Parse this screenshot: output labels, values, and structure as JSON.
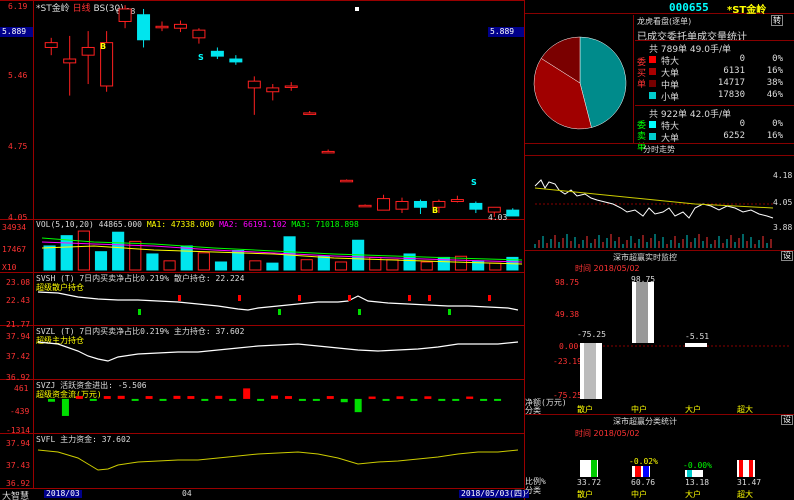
{
  "main": {
    "title": "*ST金岭",
    "period": "日线",
    "bs_label": "BS(30)",
    "peak_label": "6.18",
    "low_label": "4.03",
    "price_axis": [
      "6.19",
      "5.46",
      "4.75",
      "4.05"
    ],
    "current_price_left": "5.889",
    "current_price_right": "5.889",
    "markers": {
      "b": "B",
      "s": "S"
    }
  },
  "volume": {
    "header_label": "VOL(5,10,20)",
    "header_value": "44865.000",
    "ma1": "MA1: 47338.000",
    "ma2": "MA2: 66191.102",
    "ma3": "MA3: 71018.898",
    "axis": [
      "34934",
      "17467",
      "X10"
    ]
  },
  "svsh": {
    "header": "SVSH (T) 7日内买卖净占比0.219% 散户持仓: 22.224",
    "sub": "超级散户持仓",
    "axis": [
      "23.08",
      "22.43",
      "21.77"
    ]
  },
  "svzl": {
    "header": "SVZL (T) 7日内买卖净占比0.219% 主力持仓: 37.602",
    "sub": "超级主力持仓",
    "axis": [
      "37.94",
      "37.42",
      "36.92"
    ]
  },
  "svzj": {
    "header": "SVZJ 活跃资金进出: -5.506",
    "sub": "超级资金流(万元)",
    "axis": [
      "461",
      "-439",
      "-1314"
    ]
  },
  "svfl": {
    "header": "SVFL 主力资金: 37.602",
    "axis": [
      "37.94",
      "37.43",
      "36.92"
    ]
  },
  "bottom": {
    "brand": "大智慧",
    "date1": "2018/03",
    "date2": "04",
    "date3": "2018/05/03(四)"
  },
  "right": {
    "code": "000655",
    "name": "*ST金岭",
    "tab_label": "转",
    "panel_title": "龙虎看盘(逐单)",
    "order_title": "已成交委托单成交量统计",
    "buy": {
      "side_label": "委买单",
      "total": "共 789单 49.0手/单",
      "rows": [
        {
          "label": "特大",
          "vol": "0",
          "pct": "0%"
        },
        {
          "label": "大单",
          "vol": "6131",
          "pct": "16%"
        },
        {
          "label": "中单",
          "vol": "14717",
          "pct": "38%"
        },
        {
          "label": "小单",
          "vol": "17830",
          "pct": "46%"
        }
      ]
    },
    "sell": {
      "side_label": "委卖单",
      "total": "共 922单 42.0手/单",
      "rows": [
        {
          "label": "特大",
          "vol": "0",
          "pct": "0%"
        },
        {
          "label": "大单",
          "vol": "6252",
          "pct": "16%"
        }
      ]
    },
    "intraday_title": "分时走势",
    "intraday_prices": [
      "4.18",
      "4.05",
      "3.88"
    ],
    "realtime_title": "深市超赢实时监控",
    "realtime_tab": "设",
    "realtime_time": "时间  2018/05/02",
    "realtime_axis": [
      "98.75",
      "49.38",
      "0.00",
      "-23.19",
      "-75.25"
    ],
    "realtime_vals": {
      "a": "-75.25",
      "b": "98.75",
      "c": "-5.51"
    },
    "net_label": "净额(万元)",
    "cat_label": "分类",
    "categories": [
      "散户",
      "中户",
      "大户",
      "超大"
    ],
    "class_title": "深市超赢分类统计",
    "class_tab": "设",
    "class_time": "时间  2018/05/02",
    "class_axis_label": "比例%",
    "class_vals": {
      "a": "33.72",
      "b": "-0.02%",
      "b2": "60.76",
      "c": "-0.00%",
      "c2": "13.18",
      "d": "31.47"
    }
  },
  "chart_data": [
    {
      "type": "candlestick",
      "title": "*ST金岭",
      "ylim": [
        4.05,
        6.19
      ],
      "candles": [
        {
          "o": 5.78,
          "c": 5.83,
          "h": 5.88,
          "l": 5.7
        },
        {
          "o": 5.62,
          "c": 5.66,
          "h": 5.9,
          "l": 5.28
        },
        {
          "o": 5.7,
          "c": 5.78,
          "h": 5.95,
          "l": 5.4
        },
        {
          "o": 5.38,
          "c": 5.83,
          "h": 5.95,
          "l": 5.32
        },
        {
          "o": 6.05,
          "c": 6.18,
          "h": 6.22,
          "l": 5.98
        },
        {
          "o": 6.12,
          "c": 5.86,
          "h": 6.18,
          "l": 5.78
        },
        {
          "o": 6.0,
          "c": 6.0,
          "h": 6.05,
          "l": 5.95
        },
        {
          "o": 5.98,
          "c": 6.02,
          "h": 6.06,
          "l": 5.94
        },
        {
          "o": 5.88,
          "c": 5.96,
          "h": 5.98,
          "l": 5.82
        },
        {
          "o": 5.74,
          "c": 5.69,
          "h": 5.78,
          "l": 5.66
        },
        {
          "o": 5.66,
          "c": 5.63,
          "h": 5.7,
          "l": 5.6
        },
        {
          "o": 5.36,
          "c": 5.43,
          "h": 5.48,
          "l": 5.08
        },
        {
          "o": 5.32,
          "c": 5.36,
          "h": 5.4,
          "l": 5.23
        },
        {
          "o": 5.38,
          "c": 5.38,
          "h": 5.42,
          "l": 5.33
        },
        {
          "o": 5.1,
          "c": 5.1,
          "h": 5.12,
          "l": 5.08
        },
        {
          "o": 4.7,
          "c": 4.7,
          "h": 4.72,
          "l": 4.68
        },
        {
          "o": 4.4,
          "c": 4.4,
          "h": 4.41,
          "l": 4.39
        },
        {
          "o": 4.14,
          "c": 4.14,
          "h": 4.15,
          "l": 4.13
        },
        {
          "o": 4.09,
          "c": 4.21,
          "h": 4.25,
          "l": 4.09
        },
        {
          "o": 4.1,
          "c": 4.18,
          "h": 4.22,
          "l": 4.06
        },
        {
          "o": 4.18,
          "c": 4.12,
          "h": 4.2,
          "l": 4.05
        },
        {
          "o": 4.12,
          "c": 4.18,
          "h": 4.2,
          "l": 4.06
        },
        {
          "o": 4.18,
          "c": 4.2,
          "h": 4.24,
          "l": 4.17
        },
        {
          "o": 4.16,
          "c": 4.1,
          "h": 4.18,
          "l": 4.06
        },
        {
          "o": 4.07,
          "c": 4.12,
          "h": 4.12,
          "l": 4.02
        },
        {
          "o": 4.09,
          "c": 4.03,
          "h": 4.11,
          "l": 4.03
        }
      ],
      "bull_color": "#ff2020",
      "bear_color": "#00e5ee"
    },
    {
      "type": "bar",
      "title": "VOL(5,10,20)",
      "ylim": [
        0,
        34934
      ],
      "values": [
        21000,
        30000,
        34000,
        16000,
        33000,
        25000,
        14000,
        8000,
        21000,
        15000,
        7000,
        17000,
        8000,
        6000,
        29000,
        9000,
        12000,
        7000,
        26000,
        11000,
        9000,
        14000,
        7000,
        11000,
        12000,
        8000,
        6000,
        11000
      ],
      "bull_mask": [
        0,
        0,
        1,
        0,
        0,
        1,
        0,
        1,
        0,
        1,
        0,
        0,
        1,
        0,
        0,
        1,
        0,
        1,
        0,
        1,
        1,
        0,
        1,
        0,
        1,
        0,
        1,
        0
      ]
    },
    {
      "type": "bar",
      "title": "SVZJ",
      "ylim": [
        -1314,
        461
      ],
      "values": [
        -120,
        -720,
        120,
        -40,
        120,
        130,
        -30,
        120,
        -10,
        130,
        120,
        -30,
        130,
        -20,
        445,
        -30,
        140,
        120,
        -20,
        -40,
        120,
        -140,
        -560,
        100,
        -30,
        110,
        -40,
        110,
        -30,
        -40,
        100,
        -30,
        -40
      ]
    }
  ]
}
